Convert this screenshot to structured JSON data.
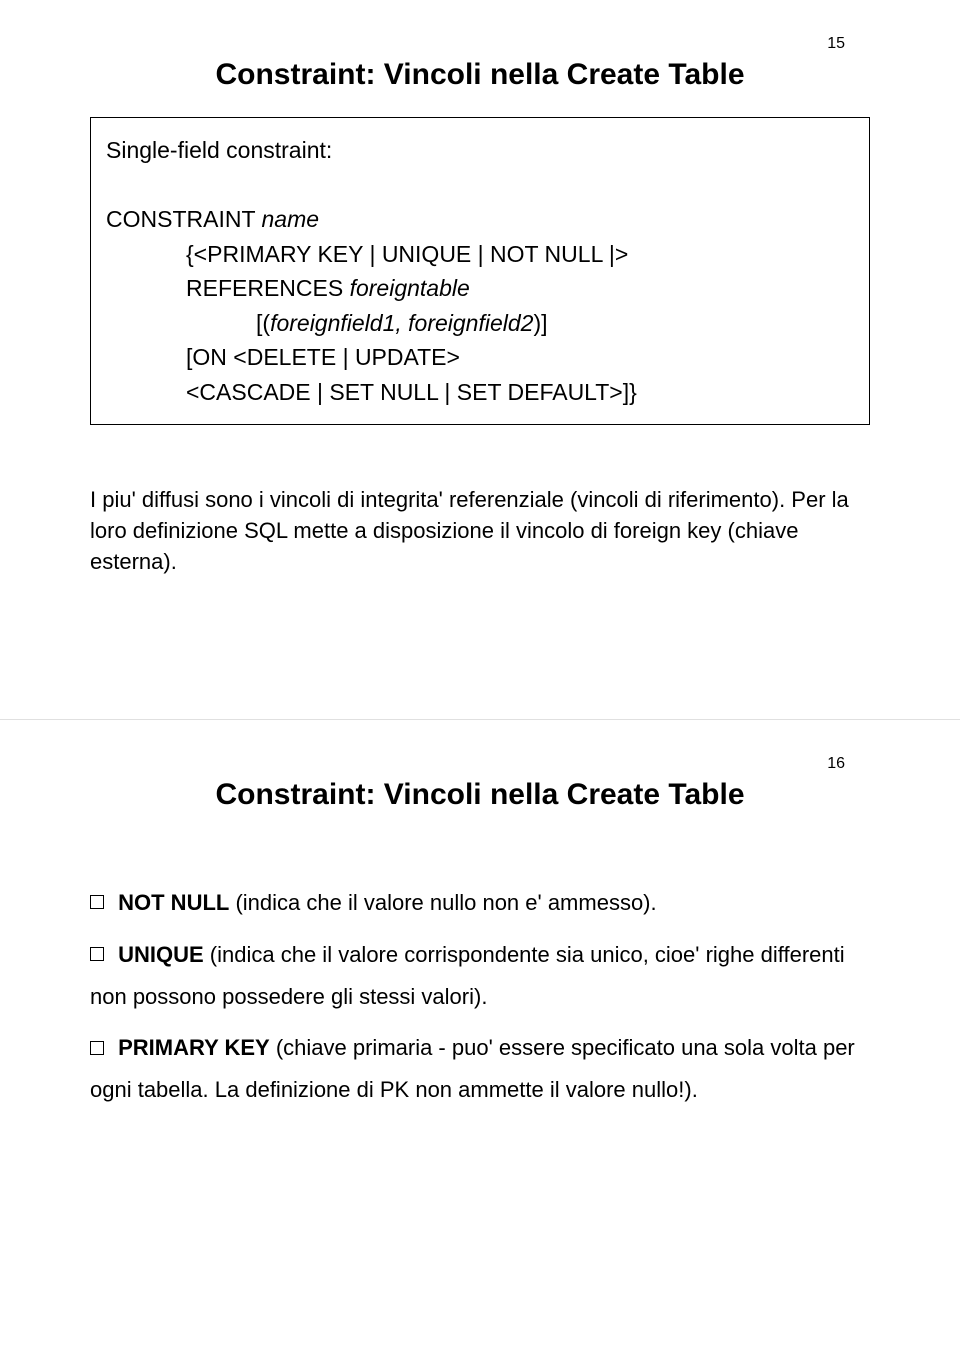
{
  "slide1": {
    "page_number": "15",
    "title": "Constraint: Vincoli nella Create Table",
    "syntax": {
      "intro": "Single-field constraint:",
      "line1_prefix": "CONSTRAINT ",
      "line1_name": "name",
      "line2": "{<PRIMARY KEY | UNIQUE | NOT NULL |>",
      "line3_prefix": "REFERENCES ",
      "line3_table": "foreigntable",
      "line4_prefix": "[(",
      "line4_fields": "foreignfield1, foreignfield2",
      "line4_suffix": ")]",
      "line5": "[ON <DELETE | UPDATE>",
      "line6": "<CASCADE | SET NULL | SET DEFAULT>]}"
    },
    "description": "I piu' diffusi sono i vincoli di integrita' referenziale (vincoli di riferimento). Per la loro definizione SQL mette a disposizione il vincolo di foreign key (chiave esterna)."
  },
  "slide2": {
    "page_number": "16",
    "title": "Constraint: Vincoli nella Create Table",
    "bullets": [
      {
        "keyword": "NOT NULL",
        "text": " (indica che il valore nullo non e' ammesso)."
      },
      {
        "keyword": "UNIQUE",
        "text": " (indica che il valore corrispondente sia unico, cioe' righe differenti non possono possedere gli stessi valori)."
      },
      {
        "keyword": "PRIMARY KEY",
        "text": " (chiave primaria - puo' essere specificato una sola volta per ogni tabella. La definizione di PK non ammette il valore nullo!)."
      }
    ]
  }
}
